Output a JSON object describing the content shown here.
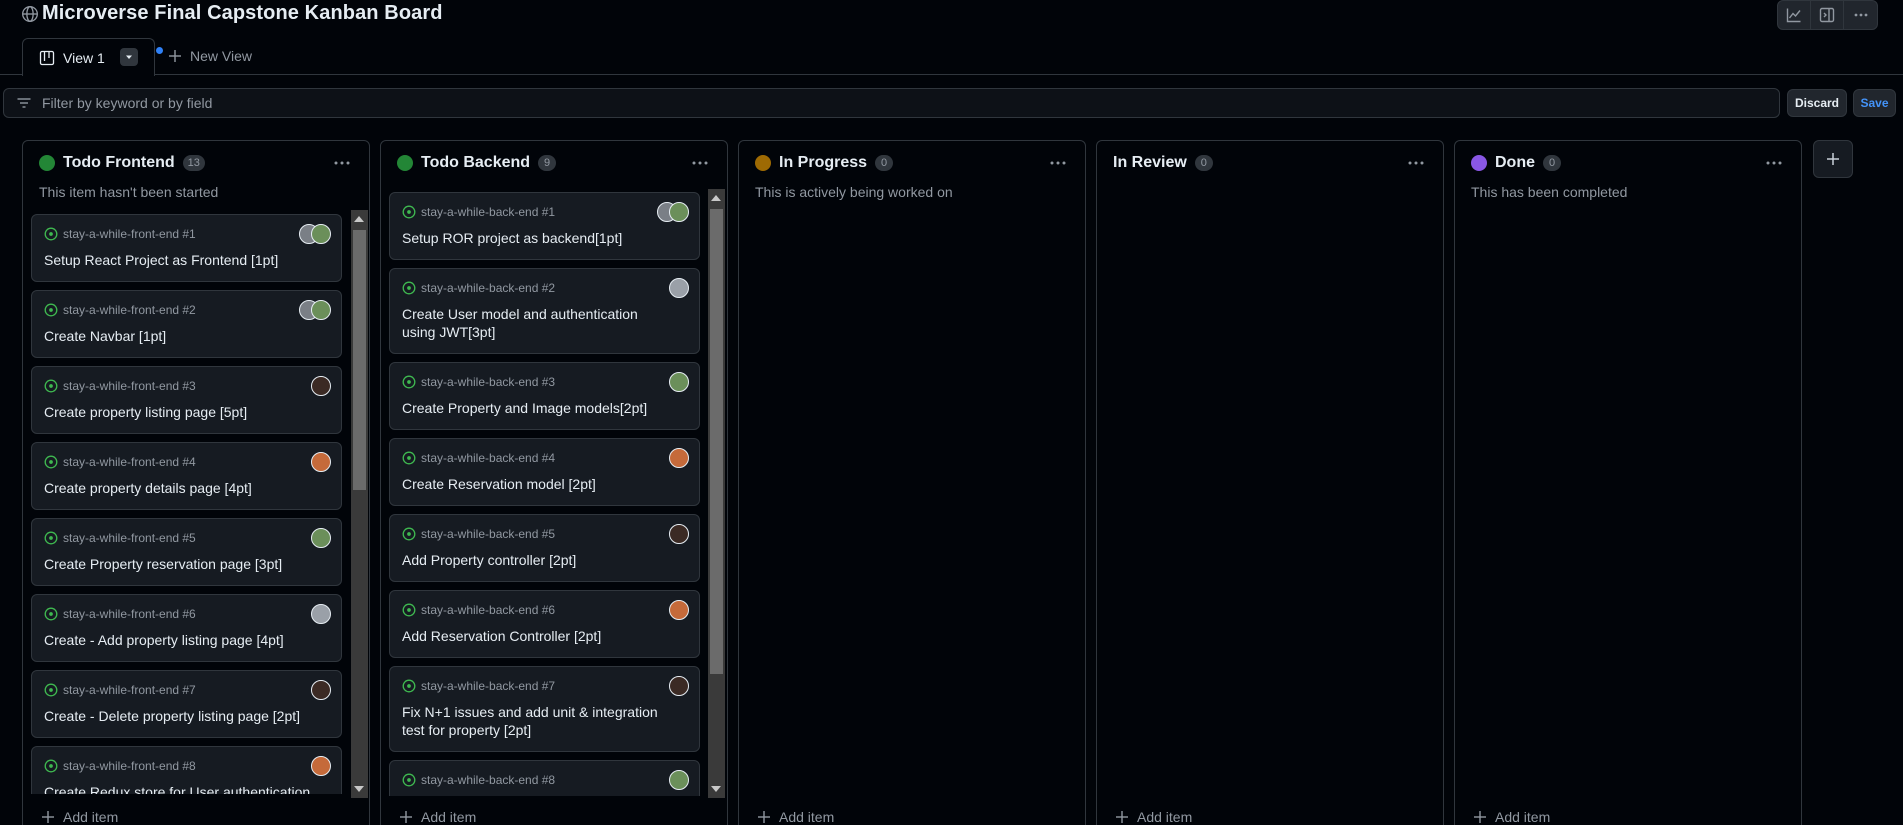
{
  "header": {
    "title": "Microverse Final Capstone Kanban Board",
    "icons": [
      "insights-icon",
      "side-panel-icon",
      "more-icon"
    ]
  },
  "tabs": {
    "active_label": "View 1",
    "new_label": "New View"
  },
  "filter": {
    "placeholder": "Filter by keyword or by field",
    "discard_label": "Discard",
    "save_label": "Save"
  },
  "colors": {
    "todo": "#238636",
    "in_progress": "#9e6a03",
    "done": "#8957e5",
    "open_issue": "#3fb950"
  },
  "add_item_label": "Add item",
  "columns": [
    {
      "title": "Todo Frontend",
      "count": "13",
      "description": "This item hasn't been started",
      "cards": [
        {
          "repo": "stay-a-while-front-end #1",
          "title": "Setup React Project as Frontend [1pt]"
        },
        {
          "repo": "stay-a-while-front-end #2",
          "title": "Create Navbar [1pt]"
        },
        {
          "repo": "stay-a-while-front-end #3",
          "title": "Create property listing page [5pt]"
        },
        {
          "repo": "stay-a-while-front-end #4",
          "title": "Create property details page [4pt]"
        },
        {
          "repo": "stay-a-while-front-end #5",
          "title": "Create Property reservation page [3pt]"
        },
        {
          "repo": "stay-a-while-front-end #6",
          "title": "Create - Add property listing page [4pt]"
        },
        {
          "repo": "stay-a-while-front-end #7",
          "title": "Create - Delete property listing page [2pt]"
        },
        {
          "repo": "stay-a-while-front-end #8",
          "title": "Create Redux store for User authentication"
        }
      ]
    },
    {
      "title": "Todo Backend",
      "count": "9",
      "description": "",
      "cards": [
        {
          "repo": "stay-a-while-back-end #1",
          "title": "Setup ROR project as backend[1pt]"
        },
        {
          "repo": "stay-a-while-back-end #2",
          "title": "Create User model and authentication using JWT[3pt]"
        },
        {
          "repo": "stay-a-while-back-end #3",
          "title": "Create Property and Image models[2pt]"
        },
        {
          "repo": "stay-a-while-back-end #4",
          "title": "Create Reservation model [2pt]"
        },
        {
          "repo": "stay-a-while-back-end #5",
          "title": "Add Property controller [2pt]"
        },
        {
          "repo": "stay-a-while-back-end #6",
          "title": "Add Reservation Controller [2pt]"
        },
        {
          "repo": "stay-a-while-back-end #7",
          "title": "Fix N+1 issues and add unit & integration test for property [2pt]"
        },
        {
          "repo": "stay-a-while-back-end #8",
          "title": ""
        }
      ]
    },
    {
      "title": "In Progress",
      "count": "0",
      "description": "This is actively being worked on",
      "cards": []
    },
    {
      "title": "In Review",
      "count": "0",
      "description": "",
      "cards": []
    },
    {
      "title": "Done",
      "count": "0",
      "description": "This has been completed",
      "cards": []
    }
  ]
}
